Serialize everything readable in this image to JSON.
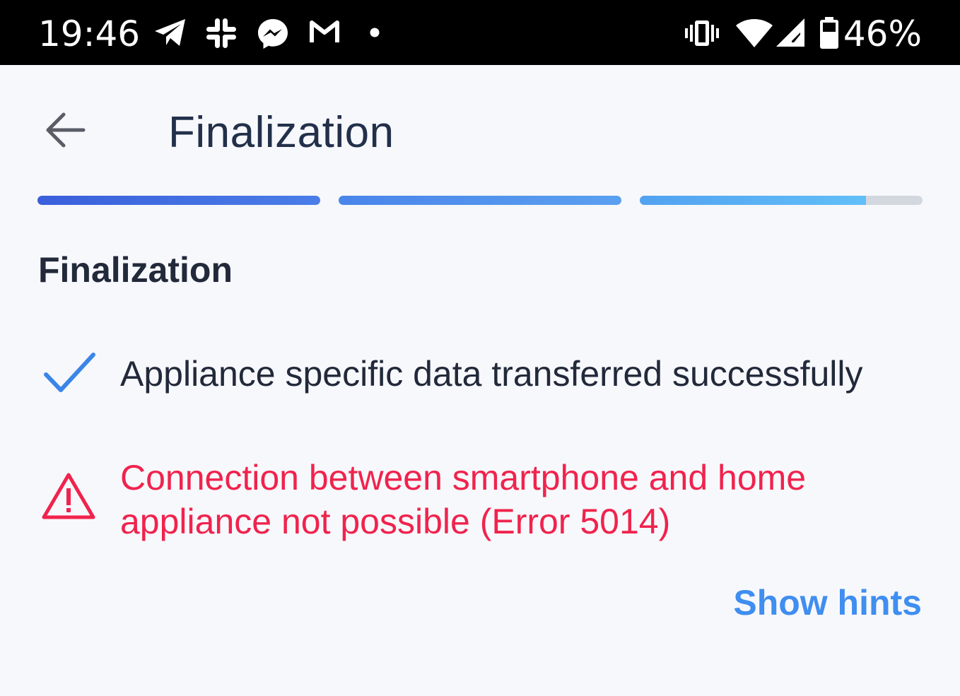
{
  "status_bar": {
    "time": "19:46",
    "battery_percent": "46%",
    "notification_icons": [
      "telegram-icon",
      "slack-icon",
      "messenger-icon",
      "gmail-icon",
      "more-notifications-dot-icon"
    ],
    "system_icons": [
      "vibrate-icon",
      "wifi-icon",
      "cellular-signal-icon",
      "battery-icon"
    ]
  },
  "app_bar": {
    "title": "Finalization",
    "back_icon": "arrow-left-icon"
  },
  "progress": {
    "steps": [
      {
        "fraction": 1.0,
        "color": "#3a5fdb"
      },
      {
        "fraction": 1.0,
        "color": "#4a85ea"
      },
      {
        "fraction": 0.8,
        "color": "#52a2f0"
      }
    ],
    "track_color": "#d3d7de"
  },
  "content": {
    "section_title": "Finalization",
    "success_message": "Appliance specific data transferred successfully",
    "error_message": "Connection between smartphone and home appliance not possible (Error 5014)",
    "show_hints_label": "Show hints"
  },
  "colors": {
    "background": "#f7f8fc",
    "text": "#22293a",
    "success_check": "#3a86e8",
    "error": "#f0234d",
    "link": "#3f8ef0"
  }
}
